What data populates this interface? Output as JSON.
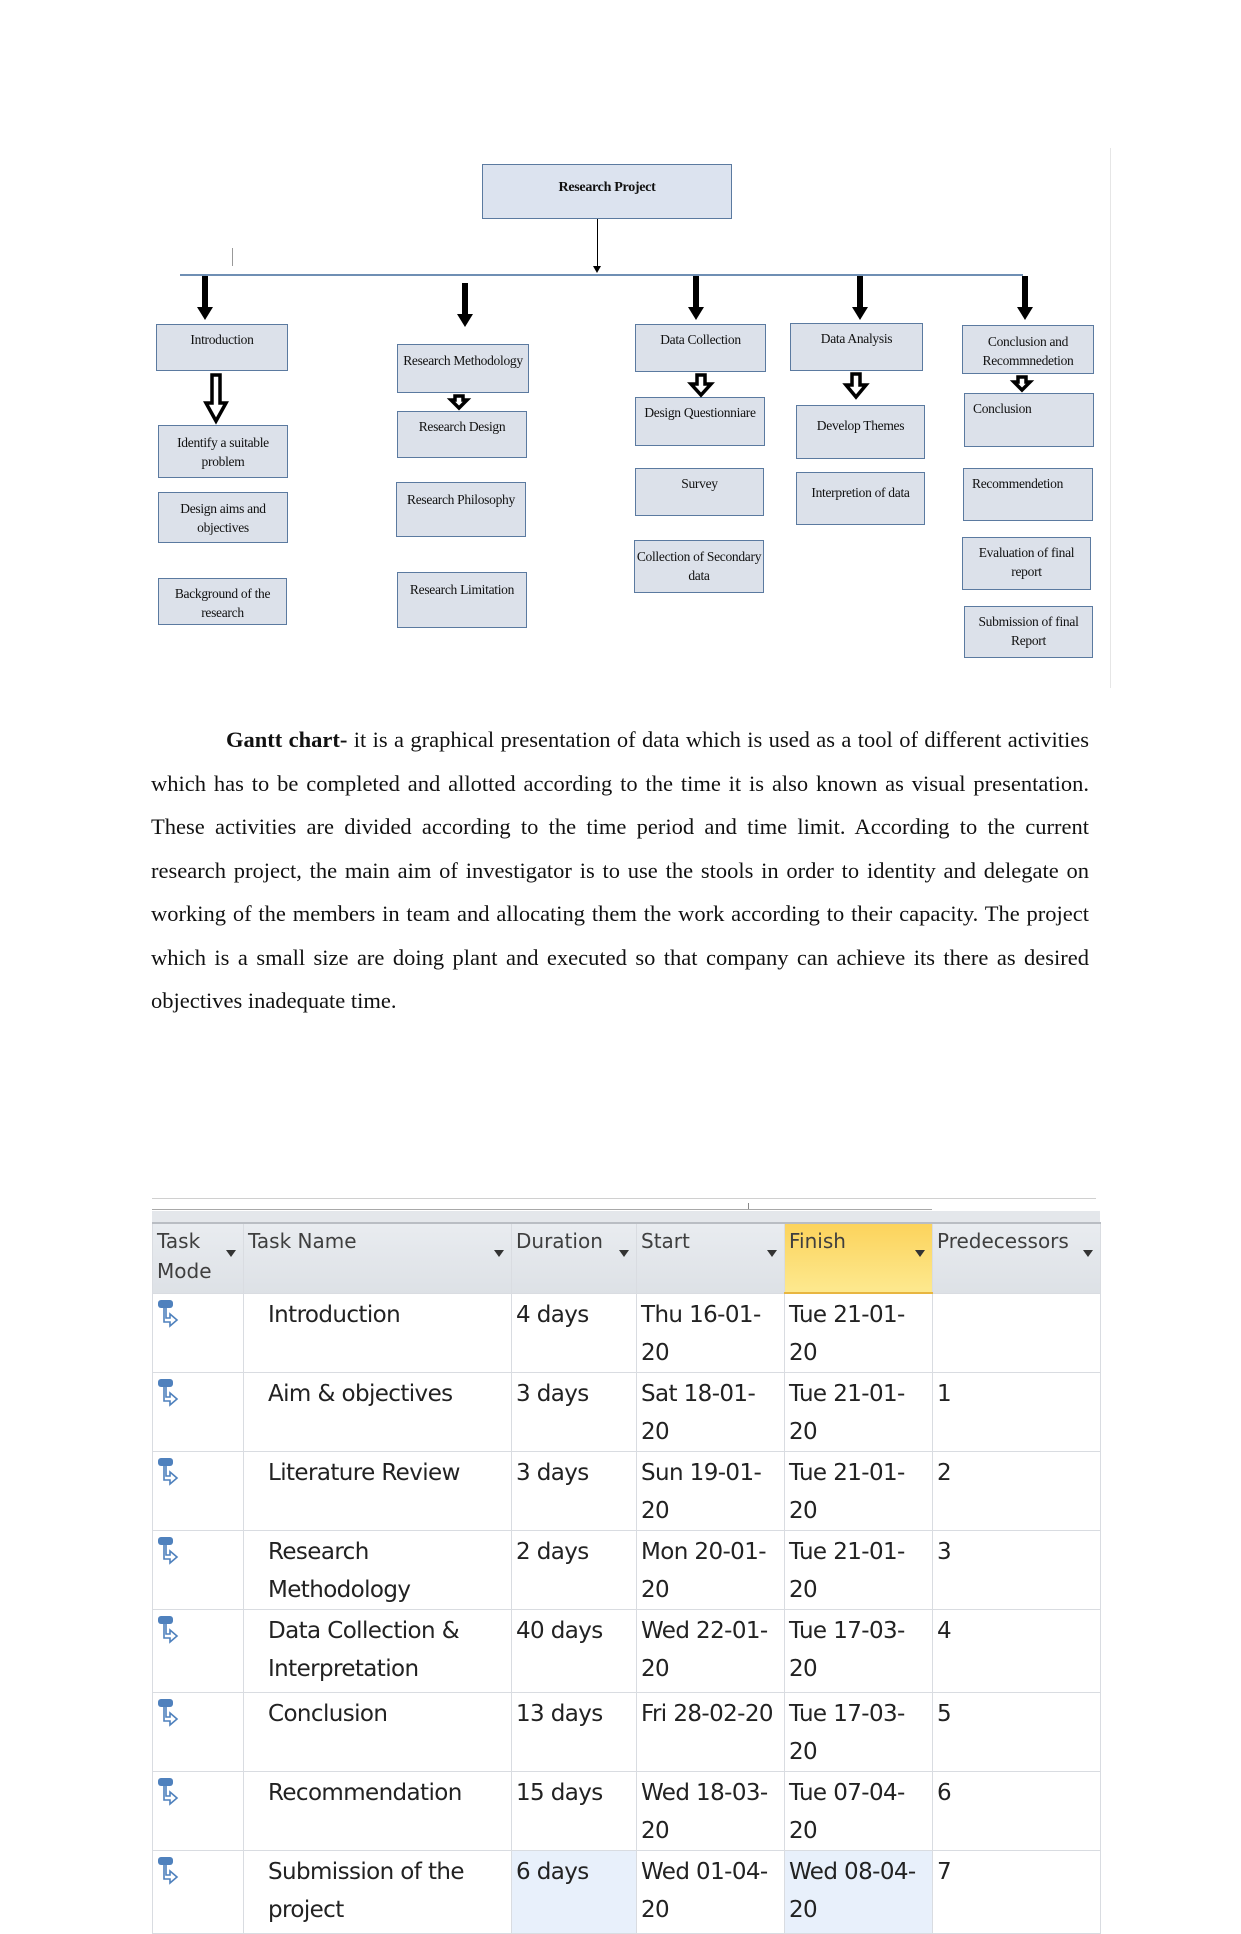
{
  "diagram": {
    "root": "Research Project",
    "columns": [
      {
        "head": "Introduction",
        "children": [
          "Identify a suitable problem",
          "Design aims and objectives",
          "Background of the research"
        ]
      },
      {
        "head": "Research Methodology",
        "children": [
          "Research Design",
          "Research Philosophy",
          "Research Limitation"
        ]
      },
      {
        "head": "Data Collection",
        "children": [
          "Design Questionniare",
          "Survey",
          "Collection of Secondary data"
        ]
      },
      {
        "head": "Data Analysis",
        "children": [
          "Develop Themes",
          "Interpretion of data"
        ]
      },
      {
        "head": "Conclusion and Recommnedetion",
        "children": [
          "Conclusion",
          "Recommendetion",
          "Evaluation of final report",
          "Submission of final Report"
        ]
      }
    ],
    "colors": {
      "box_fill": "#dce1ea",
      "box_border": "#5b7aa0",
      "connector": "#6f8fb4"
    }
  },
  "paragraph": {
    "lead": "Gantt chart-",
    "body": " it is a graphical presentation of data which is used as a tool of different activities which has to be completed and allotted according to the time it is also known as visual presentation. These activities are divided according to the time period and time limit. According to the current research project, the main aim of investigator is to use the stools in order to identity and delegate on working of the members in team and allocating them the work according to their capacity. The project which is a small size are doing plant and executed so that company can achieve its there as desired objectives inadequate time."
  },
  "gantt": {
    "headers": {
      "mode": "Task Mode",
      "name": "Task Name",
      "duration": "Duration",
      "start": "Start",
      "finish": "Finish",
      "predecessors": "Predecessors"
    },
    "icons": {
      "mode": "auto-scheduled-task-icon",
      "dropdown": "dropdown-arrow-icon"
    },
    "colors": {
      "finish_header": "#fcd35c",
      "selected_cell": "#e8f0fb",
      "mode_icon": "#4f81bd"
    },
    "rows": [
      {
        "name": "Introduction",
        "duration": "4 days",
        "start": "Thu 16-01-20",
        "finish": "Tue 21-01-20",
        "predecessors": ""
      },
      {
        "name": "Aim & objectives",
        "duration": "3 days",
        "start": "Sat 18-01-20",
        "finish": "Tue 21-01-20",
        "predecessors": "1"
      },
      {
        "name": "Literature Review",
        "duration": "3 days",
        "start": "Sun 19-01-20",
        "finish": "Tue 21-01-20",
        "predecessors": "2"
      },
      {
        "name": "Research Methodology",
        "duration": "2 days",
        "start": "Mon 20-01-20",
        "finish": "Tue 21-01-20",
        "predecessors": "3"
      },
      {
        "name": "Data Collection & Interpretation",
        "duration": "40 days",
        "start": "Wed 22-01-20",
        "finish": "Tue 17-03-20",
        "predecessors": "4"
      },
      {
        "name": "Conclusion",
        "duration": "13 days",
        "start": "Fri 28-02-20",
        "finish": "Tue 17-03-20",
        "predecessors": "5"
      },
      {
        "name": "Recommendation",
        "duration": "15 days",
        "start": "Wed 18-03-20",
        "finish": "Tue 07-04-20",
        "predecessors": "6"
      },
      {
        "name": "Submission of the project",
        "duration": "6 days",
        "start": "Wed 01-04-20",
        "finish": "Wed 08-04-20",
        "predecessors": "7"
      }
    ]
  }
}
